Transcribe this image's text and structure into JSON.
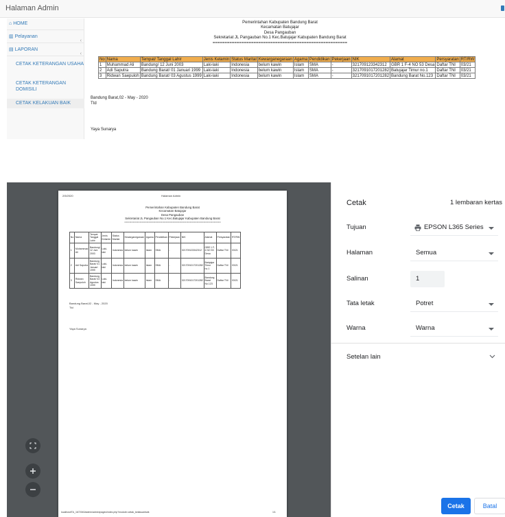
{
  "admin": {
    "title": "Halaman Admin",
    "sidebar": {
      "home": "HOME",
      "pelayanan": "Pelayanan",
      "laporan": "LAPORAN",
      "sub1": "CETAK KETERANGAN USAHA",
      "sub2": "CETAK KETERANGAN DOMISILI",
      "sub3": "CETAK KELAKUAN BAIK"
    },
    "report": {
      "line1": "Pemerintahan Kabupaten Bandung Barat",
      "line2": "Kecamatan Batujajar",
      "line3": "Desa Pangauban",
      "line4": "Sekretariat JL Pangauban No.1 Kec.Batujajar Kabupaten Bandung Barat",
      "separator": "========================================================",
      "columns": [
        "No",
        "Nama",
        "Tempat/ Tanggal Lahir",
        "Jenis Kelamin",
        "Status Marital",
        "Kewarganegaraan",
        "Agama",
        "Pendidikan",
        "Pekerjaan",
        "NIK",
        "Alamat",
        "Persyaratan",
        "RT/RW"
      ],
      "rows": [
        [
          "1",
          "Muhammad Ali",
          "Bandung/ 12 Juni 2003",
          "Laki-laki",
          "Indonesia",
          "belum kawin",
          "Islam",
          "SMA",
          "-",
          "321709123342312",
          "GBR 1 F-4 NO 53 Desa",
          "Daftar TNI",
          "03/21"
        ],
        [
          "2",
          "Adi Saputra",
          "Bandung Barat/ 01 Januari 1999",
          "Laki-laki",
          "Indonesia",
          "belum kawin",
          "Islam",
          "SMA",
          "-",
          "3217091017201282",
          "Batujajar Timur no.1",
          "Daftar TNI",
          "03/21"
        ],
        [
          "3",
          "Ridwan Saepuloh",
          "Bandung Barat/ 03 Agustus 1999",
          "Laki-laki",
          "Indonesia",
          "belum kawin",
          "Islam",
          "SMA",
          "-",
          "3217091017201282",
          "Bandung Barat No.123",
          "Daftar TNI",
          "03/21"
        ]
      ],
      "date_line": "Bandung Barat,02 - May - 2020",
      "ttd": "Ttd",
      "signer": "Yaya Sunarya"
    }
  },
  "preview": {
    "date": "2/5/2020",
    "page_title": "Halaman Admin",
    "columns": [
      "No",
      "Nama",
      "Tempat Tanggal Lahir",
      "Jenis Kelamin",
      "Status Marital",
      "Kewarganegaraan",
      "Agama",
      "Pendidikan",
      "Pekerjaan",
      "NIK",
      "Alamat",
      "Persyaratan",
      "RT/RW"
    ],
    "rows": [
      [
        "1",
        "Muhammad Ali",
        "Bandung/ 12 Juni 2003",
        "Laki-laki",
        "Indonesia",
        "belum kawin",
        "Islam",
        "SMA",
        "-",
        "321709123342312",
        "GBR 1 F-4 NO 53 Desa",
        "Daftar TNI",
        "03/21"
      ],
      [
        "2",
        "Adi Saputra",
        "Bandung Barat/ 01 Januari 1999",
        "Laki-laki",
        "Indonesia",
        "belum kawin",
        "Islam",
        "SMA",
        "-",
        "3217091017201282",
        "Batujajar Timur no.1",
        "Daftar TNI",
        "03/21"
      ],
      [
        "3",
        "Ridwan Saepuloh",
        "Bandung Barat/ 03 Agustus 1999",
        "Laki-laki",
        "Indonesia",
        "belum kawin",
        "Islam",
        "SMA",
        "-",
        "3217091017201282",
        "Bandung Barat No.123",
        "Daftar TNI",
        "03/21"
      ]
    ],
    "url": "localhost/TA_1672040/admin/admin/pages/index.php?module=cetak_kelakuanbaik",
    "page_num": "1/1"
  },
  "print": {
    "title": "Cetak",
    "sheets": "1 lembaran kertas",
    "tujuan_label": "Tujuan",
    "tujuan_value": "EPSON L365 Series",
    "halaman_label": "Halaman",
    "halaman_value": "Semua",
    "salinan_label": "Salinan",
    "salinan_value": "1",
    "tata_letak_label": "Tata letak",
    "tata_letak_value": "Potret",
    "warna_label": "Warna",
    "warna_value": "Warna",
    "setelan_lain": "Setelan lain",
    "print_button": "Cetak",
    "cancel_button": "Batal"
  },
  "colors": {
    "accent": "#1a73e8",
    "table_header": "#f0ad4e",
    "preview_bg": "#525659",
    "link": "#337ab7"
  }
}
